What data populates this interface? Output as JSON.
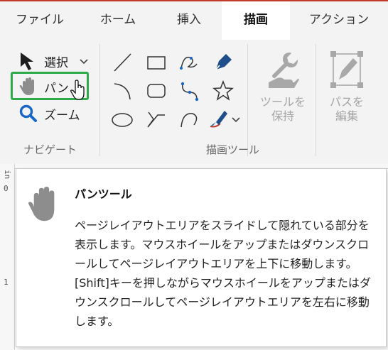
{
  "tabs": [
    {
      "label": "ファイル",
      "active": false
    },
    {
      "label": "ホーム",
      "active": false
    },
    {
      "label": "挿入",
      "active": false
    },
    {
      "label": "描画",
      "active": true
    },
    {
      "label": "アクション",
      "active": false
    }
  ],
  "navigate": {
    "select_label": "選択",
    "pan_label": "パン",
    "zoom_label": "ズーム",
    "group_label": "ナビゲート"
  },
  "draw_tools": {
    "group_label": "描画ツール",
    "icons": [
      "line-icon",
      "rectangle-icon",
      "freeform-icon",
      "pen-icon",
      "arc-icon",
      "rounded-rectangle-icon",
      "bezier-icon",
      "star-icon",
      "ellipse-icon",
      "polyline-icon",
      "curve-icon",
      "ink-brush-icon"
    ]
  },
  "big_buttons": {
    "keep_tool_label_1": "ツールを",
    "keep_tool_label_2": "保持",
    "edit_path_label_1": "パスを",
    "edit_path_label_2": "編集"
  },
  "ruler": {
    "unit": "in",
    "mark_0": "0",
    "mark_1": "1"
  },
  "tooltip": {
    "title": "パンツール",
    "description": "ページレイアウトエリアをスライドして隠れている部分を表示します。マウスホイールをアップまたはダウンスクロールしてページレイアウトエリアを上下に移動します。[Shift]キーを押しながらマウスホイールをアップまたはダウンスクロールしてページレイアウトエリアを左右に移動します。"
  },
  "colors": {
    "accent_red": "#c0392b",
    "pan_highlight": "#2eaa4a",
    "zoom_blue": "#1a66c8",
    "ribbon_bg": "#f3f3f3",
    "disabled_text": "#a4a4a4"
  }
}
